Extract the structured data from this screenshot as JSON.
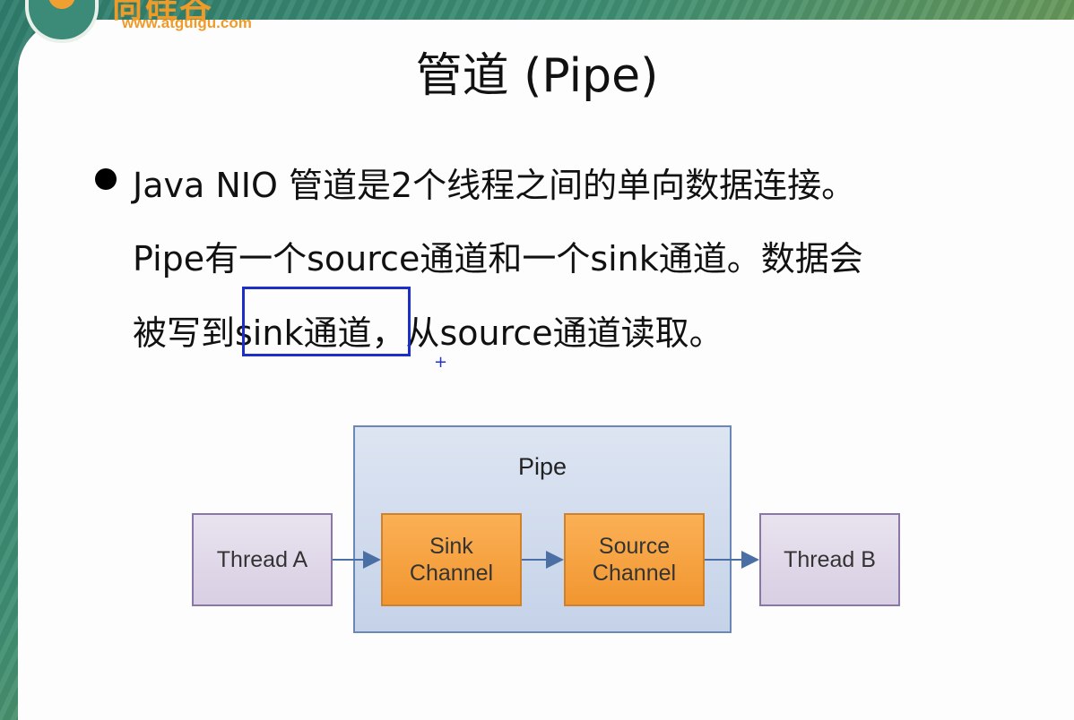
{
  "logo": {
    "brand_cn": "尚硅谷",
    "url": "www.atguigu.com"
  },
  "title": "管道 (Pipe)",
  "bullet": {
    "line1": "Java NIO 管道是2个线程之间的单向数据连接。",
    "line2": "Pipe有一个source通道和一个sink通道。数据会",
    "line3": "被写到sink通道，从source通道读取。"
  },
  "highlight_text": "sink通道",
  "diagram": {
    "pipe_label": "Pipe",
    "thread_a": "Thread A",
    "thread_b": "Thread B",
    "sink": [
      "Sink",
      "Channel"
    ],
    "source": [
      "Source",
      "Channel"
    ]
  },
  "colors": {
    "channel_fill": "#f5a340",
    "thread_fill": "#ddd5e8",
    "pipe_fill": "#cfdaec",
    "arrow": "#4a6fa5",
    "highlight": "#1e2fc8"
  }
}
